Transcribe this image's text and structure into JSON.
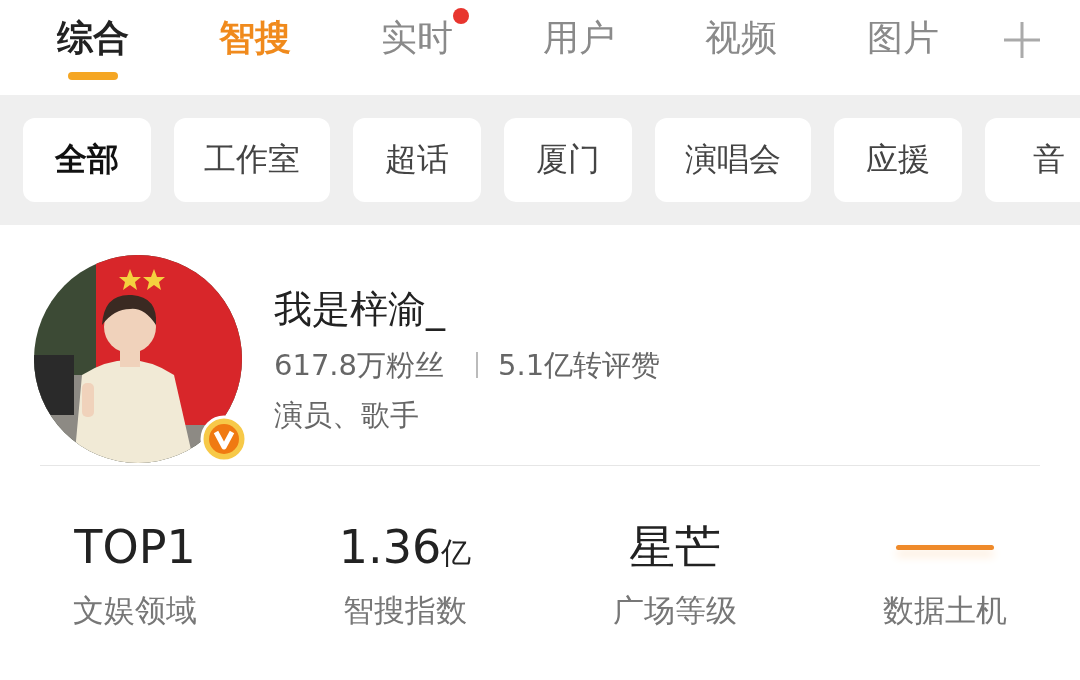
{
  "tabs": [
    {
      "label": "综合",
      "selected": true,
      "kind": "normal",
      "dot": false
    },
    {
      "label": "智搜",
      "selected": false,
      "kind": "highlight",
      "dot": false
    },
    {
      "label": "实时",
      "selected": false,
      "kind": "normal",
      "dot": true
    },
    {
      "label": "用户",
      "selected": false,
      "kind": "normal",
      "dot": false
    },
    {
      "label": "视频",
      "selected": false,
      "kind": "normal",
      "dot": false
    },
    {
      "label": "图片",
      "selected": false,
      "kind": "normal",
      "dot": false
    }
  ],
  "filters": [
    {
      "label": "全部",
      "selected": true
    },
    {
      "label": "工作室",
      "selected": false
    },
    {
      "label": "超话",
      "selected": false
    },
    {
      "label": "厦门",
      "selected": false
    },
    {
      "label": "演唱会",
      "selected": false
    },
    {
      "label": "应援",
      "selected": false
    },
    {
      "label": "音",
      "selected": false
    }
  ],
  "profile": {
    "avatar": {
      "verified": true
    },
    "name": "我是梓渝_",
    "followers": "617.8万粉丝",
    "engagement": "5.1亿转评赞",
    "tags": "演员、歌手"
  },
  "stats": [
    {
      "kind": "text",
      "value": "TOP1",
      "label": "文娱领域"
    },
    {
      "kind": "text",
      "value": "1.36",
      "unit": "亿",
      "label": "智搜指数"
    },
    {
      "kind": "text",
      "value": "星芒",
      "label": "广场等级"
    },
    {
      "kind": "dash",
      "label": "数据土机"
    }
  ]
}
